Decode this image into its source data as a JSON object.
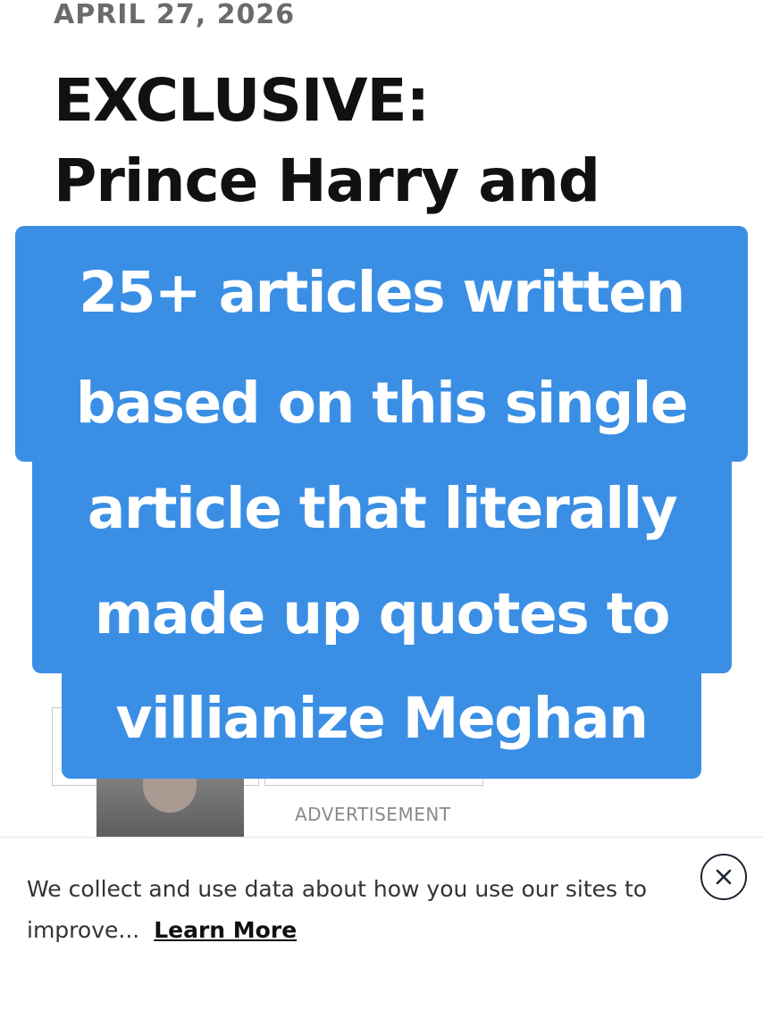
{
  "article": {
    "date": "APRIL 27, 2026",
    "headline_line1": "EXCLUSIVE:",
    "headline_line2": "Prince Harry and"
  },
  "overlay_caption": {
    "lines": [
      "25+ articles written",
      "based on this single",
      "article that literally",
      "made up quotes to",
      "villianize Meghan"
    ],
    "background_color": "#3a8fe5",
    "text_color": "#ffffff"
  },
  "ad": {
    "label": "ADVERTISEMENT"
  },
  "consent_banner": {
    "text": "We collect and use data about how you use our sites to improve...",
    "learn_more": "Learn More",
    "close_icon": "close-circle-icon"
  }
}
